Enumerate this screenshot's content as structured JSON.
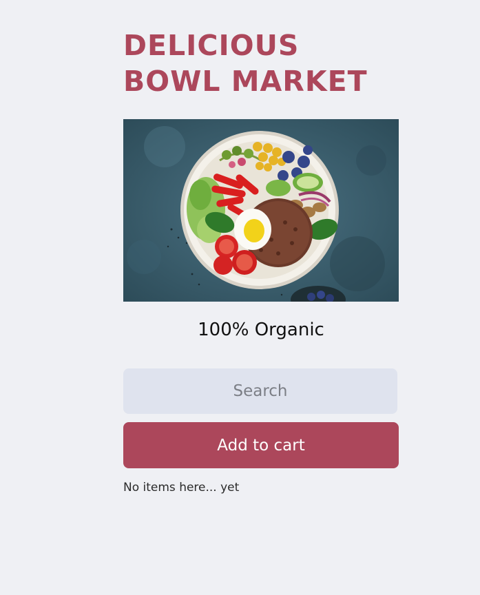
{
  "header": {
    "title_line1": "DELICIOUS",
    "title_line2": "BOWL MARKET"
  },
  "hero": {
    "image_alt": "salad bowl with quinoa, egg, tomatoes, blueberries, chickpeas and greens"
  },
  "tagline": "100% Organic",
  "search": {
    "placeholder": "Search",
    "value": ""
  },
  "cart": {
    "button_label": "Add to cart",
    "empty_message": "No items here... yet"
  },
  "colors": {
    "page_background": "#eff0f4",
    "accent": "#ac475b",
    "search_background": "#dfe3ee",
    "button_text": "#ffffff"
  }
}
